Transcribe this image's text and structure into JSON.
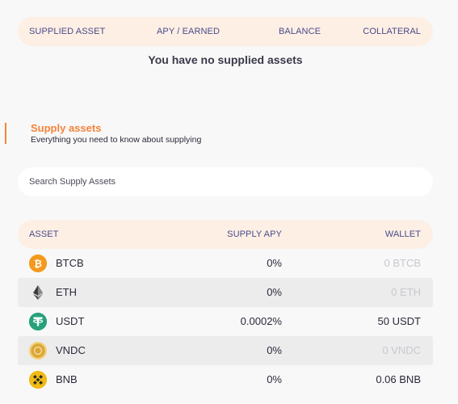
{
  "supplied": {
    "columns": [
      "SUPPLIED ASSET",
      "APY / EARNED",
      "BALANCE",
      "COLLATERAL"
    ],
    "empty_message": "You have no supplied assets"
  },
  "supply_section": {
    "title": "Supply assets",
    "subtitle": "Everything you need to know about supplying",
    "search_placeholder": "Search Supply Assets"
  },
  "assets_table": {
    "columns": [
      "ASSET",
      "SUPPLY APY",
      "WALLET"
    ],
    "rows": [
      {
        "asset": "BTCB",
        "icon": "btcb-coin-icon",
        "apy": "0%",
        "wallet": "0 BTCB",
        "wallet_muted": true
      },
      {
        "asset": "ETH",
        "icon": "eth-coin-icon",
        "apy": "0%",
        "wallet": "0 ETH",
        "wallet_muted": true
      },
      {
        "asset": "USDT",
        "icon": "usdt-coin-icon",
        "apy": "0.0002%",
        "wallet": "50 USDT",
        "wallet_muted": false
      },
      {
        "asset": "VNDC",
        "icon": "vndc-coin-icon",
        "apy": "0%",
        "wallet": "0 VNDC",
        "wallet_muted": true
      },
      {
        "asset": "BNB",
        "icon": "bnb-coin-icon",
        "apy": "0%",
        "wallet": "0.06 BNB",
        "wallet_muted": false
      }
    ]
  },
  "colors": {
    "accent": "#f5833b",
    "header_bg": "#fdefe4",
    "header_text": "#4a4a8a"
  }
}
